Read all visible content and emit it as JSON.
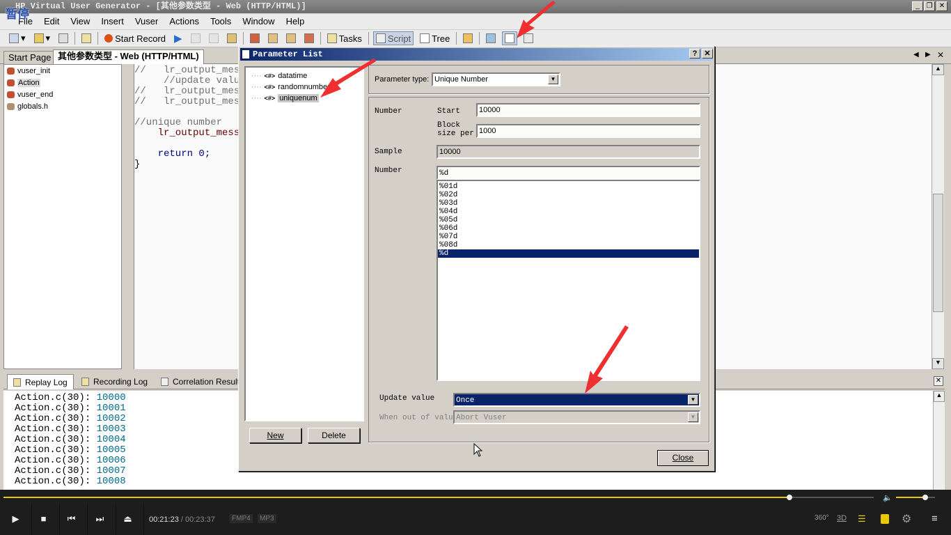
{
  "window": {
    "title": "HP Virtual User Generator - [其他参数类型 - Web (HTTP/HTML)]",
    "overlay_text": "暂停"
  },
  "menu": [
    "File",
    "Edit",
    "View",
    "Insert",
    "Vuser",
    "Actions",
    "Tools",
    "Window",
    "Help"
  ],
  "toolbar": {
    "start_record": "Start Record",
    "tasks": "Tasks",
    "script": "Script",
    "tree": "Tree"
  },
  "doc_tabs": [
    "Start Page",
    "其他参数类型 - Web (HTTP/HTML)"
  ],
  "tree": [
    "vuser_init",
    "Action",
    "vuser_end",
    "globals.h"
  ],
  "code": [
    {
      "t": "//   lr_output_messa",
      "c": "cm"
    },
    {
      "t": "     //update value",
      "c": "cm"
    },
    {
      "t": "//   lr_output_messa",
      "c": "cm"
    },
    {
      "t": "//   lr_output_messa",
      "c": "cm"
    },
    {
      "t": "",
      "c": ""
    },
    {
      "t": "//unique number",
      "c": "cm"
    },
    {
      "t": "    lr_output_messa",
      "c": "fn"
    },
    {
      "t": "",
      "c": ""
    },
    {
      "t": "    return 0;",
      "c": "kw"
    },
    {
      "t": "}",
      "c": ""
    }
  ],
  "log_tabs": [
    "Replay Log",
    "Recording Log",
    "Correlation Results"
  ],
  "log_lines": [
    {
      "p": "Action.c(30): ",
      "v": "10000"
    },
    {
      "p": "Action.c(30): ",
      "v": "10001"
    },
    {
      "p": "Action.c(30): ",
      "v": "10002"
    },
    {
      "p": "Action.c(30): ",
      "v": "10003"
    },
    {
      "p": "Action.c(30): ",
      "v": "10004"
    },
    {
      "p": "Action.c(30): ",
      "v": "10005"
    },
    {
      "p": "Action.c(30): ",
      "v": "10006"
    },
    {
      "p": "Action.c(30): ",
      "v": "10007"
    },
    {
      "p": "Action.c(30): ",
      "v": "10008"
    }
  ],
  "dialog": {
    "title": "Parameter List",
    "params": [
      "datatime",
      "randomnumber",
      "uniquenum"
    ],
    "param_icon": "<#>",
    "selected_param": "uniquenum",
    "new_label": "New",
    "delete_label": "Delete",
    "close_label": "Close",
    "param_type_label": "Parameter type:",
    "param_type": "Unique Number",
    "number_label": "Number",
    "start_label": "Start",
    "start_value": "10000",
    "block_label": "Block size per",
    "block_value": "1000",
    "sample_label": "Sample",
    "sample_value": "10000",
    "format_label": "Number",
    "format_value": "%d",
    "formats": [
      "%01d",
      "%02d",
      "%03d",
      "%04d",
      "%05d",
      "%06d",
      "%07d",
      "%08d",
      "%d"
    ],
    "selected_format": "%d",
    "update_label": "Update value",
    "update_value": "Once",
    "out_label": "When out of values",
    "out_value": "Abort Vuser"
  },
  "player": {
    "current": "00:21:23",
    "total": "00:23:37",
    "sep": "/",
    "tag1": "FMP4",
    "tag2": "MP3",
    "progress_percent": 90.3,
    "volume_percent": 75,
    "btn360": "360°",
    "btn3d": "3D"
  },
  "colors": {
    "accent": "#e8c800",
    "dialog_title": "#0a246a",
    "selection": "#0a246a",
    "arrow": "#f03030"
  }
}
